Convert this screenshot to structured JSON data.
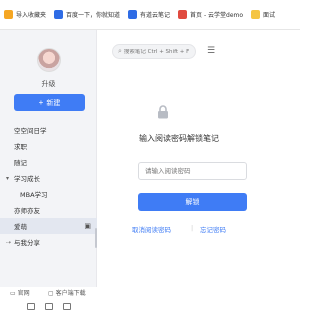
{
  "bookmarks": [
    {
      "label": "导入收藏夹",
      "icon": "folder-icon",
      "color": "#f5a623"
    },
    {
      "label": "百度一下，你就知道",
      "icon": "baidu-icon",
      "color": "#2f6ce5"
    },
    {
      "label": "有道云笔记",
      "icon": "youdao-icon",
      "color": "#2f6ce5"
    },
    {
      "label": "首页 - 云学堂demo",
      "icon": "site-icon",
      "color": "#e04a3f"
    },
    {
      "label": "面试",
      "icon": "folder-icon",
      "color": "#f5c542"
    }
  ],
  "sidebar": {
    "user_level": "升级",
    "new_button": "新建",
    "items": [
      {
        "label": "空空间日学"
      },
      {
        "label": "求职"
      },
      {
        "label": "随记"
      },
      {
        "label": "学习成长"
      },
      {
        "label": "MBA学习"
      },
      {
        "label": "亦师亦友"
      },
      {
        "label": "爱萌"
      },
      {
        "label": "与我分享"
      }
    ],
    "footer": {
      "official_site": "官网",
      "client_download": "客户端下载"
    }
  },
  "search": {
    "placeholder": "搜索笔记 Ctrl + Shift + F"
  },
  "lock_screen": {
    "title": "输入阅读密码解锁笔记",
    "password_placeholder": "请输入阅读密码",
    "unlock_button": "解锁",
    "cancel_link": "取消阅读密码",
    "forgot_link": "忘记密码"
  },
  "colors": {
    "accent": "#3f7cf5",
    "sidebar_bg": "#f3f4f7"
  }
}
